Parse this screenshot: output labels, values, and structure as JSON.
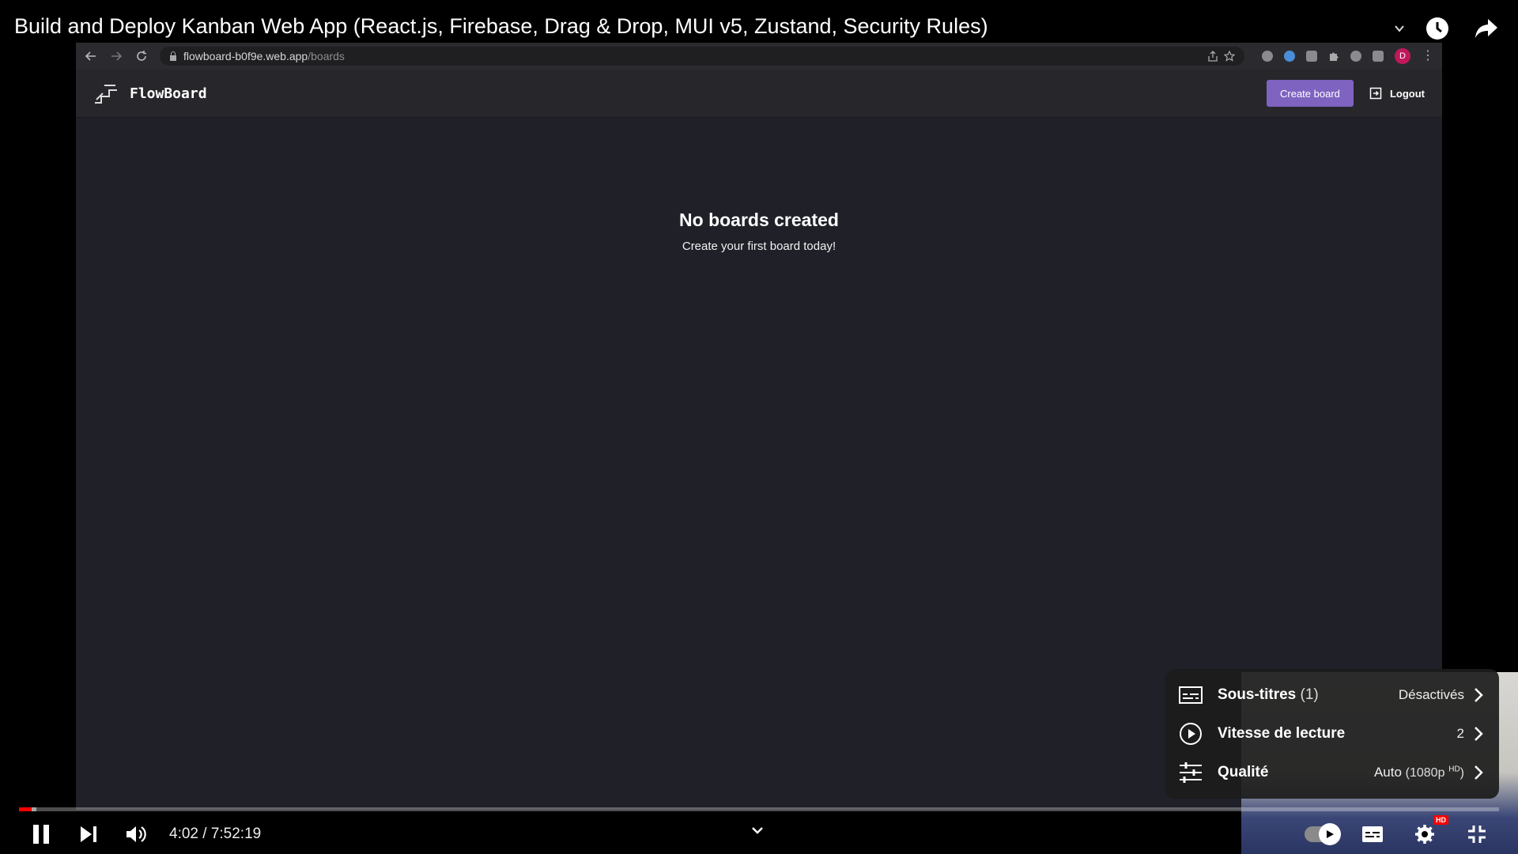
{
  "video": {
    "title": "Build and Deploy Kanban Web App (React.js, Firebase, Drag & Drop, MUI v5, Zustand, Security Rules)",
    "time": "4:02 / 7:52:19",
    "progress_fraction": 0.0085,
    "buffer_fraction": 0.012
  },
  "browser": {
    "url_host": "flowboard-b0f9e.web.app",
    "url_path": "/boards",
    "profile_initial": "D"
  },
  "app": {
    "logo_text": "FlowBoard",
    "create_board_label": "Create board",
    "logout_label": "Logout",
    "empty_title": "No boards created",
    "empty_subtitle": "Create your first board today!"
  },
  "settings_menu": {
    "subtitles_label": "Sous-titres",
    "subtitles_count": "(1)",
    "subtitles_value": "Désactivés",
    "speed_label": "Vitesse de lecture",
    "speed_value": "2",
    "quality_label": "Qualité",
    "quality_value": "Auto",
    "quality_detail": "(1080p",
    "quality_hd": "HD",
    "quality_close": ")"
  },
  "player": {
    "hd_badge": "HD"
  },
  "colors": {
    "accent": "#7e63c1",
    "progress": "#ff0000",
    "app_bg": "#1f2028"
  }
}
